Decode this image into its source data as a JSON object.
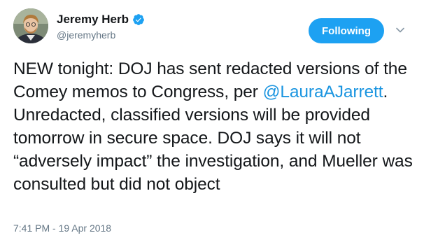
{
  "author": {
    "display_name": "Jeremy Herb",
    "handle": "@jeremyherb",
    "verified_icon": "verified-badge-icon",
    "avatar_icon": "profile-photo"
  },
  "follow_button": {
    "label": "Following"
  },
  "menu": {
    "icon": "chevron-down-icon"
  },
  "tweet": {
    "text_part1": "NEW tonight: DOJ has sent redacted versions of the Comey memos to Congress, per ",
    "mention": "@LauraAJarrett",
    "text_part2": ". Unredacted, classified versions will be provided tomorrow in secure space. DOJ says it will not “adversely impact” the investigation, and Mueller was consulted but did not object",
    "timestamp": "7:41 PM - 19 Apr 2018"
  },
  "colors": {
    "accent": "#1da1f2",
    "link": "#1b95e0",
    "secondary_text": "#657786",
    "primary_text": "#14171a"
  }
}
